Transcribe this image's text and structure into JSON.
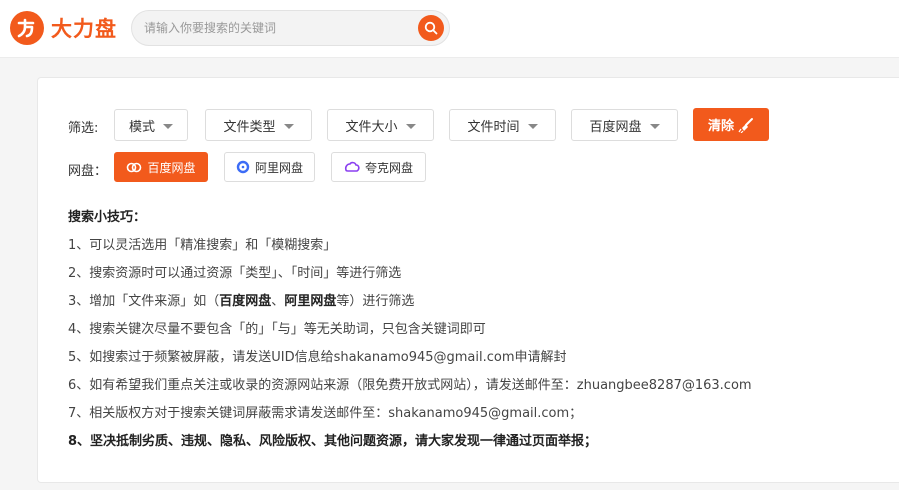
{
  "brand": {
    "name": "大力盘",
    "color": "#f25a1c"
  },
  "search": {
    "placeholder": "请输入你要搜索的关键词",
    "value": "",
    "icon": "search-icon"
  },
  "filters": {
    "label": "筛选:",
    "items": [
      {
        "label": "模式"
      },
      {
        "label": "文件类型"
      },
      {
        "label": "文件大小"
      },
      {
        "label": "文件时间"
      },
      {
        "label": "百度网盘"
      }
    ],
    "clear_label": "清除",
    "clear_icon": "broom-icon"
  },
  "disks": {
    "label": "网盘：",
    "items": [
      {
        "label": "百度网盘",
        "icon": "baidu-cloud-icon",
        "active": true
      },
      {
        "label": "阿里网盘",
        "icon": "aliyun-drive-icon",
        "active": false
      },
      {
        "label": "夸克网盘",
        "icon": "quark-drive-icon",
        "active": false
      }
    ]
  },
  "tips": {
    "title": "搜索小技巧：",
    "line1": "1、可以灵活选用「精准搜索」和「模糊搜索」",
    "line2": "2、搜索资源时可以通过资源「类型」、「时间」等进行筛选",
    "line3": {
      "prefix": "3、增加「文件来源」如（",
      "bold1": "百度网盘",
      "sep": "、",
      "bold2": "阿里网盘",
      "suffix": "等）进行筛选"
    },
    "line4": "4、搜索关键次尽量不要包含「的」「与」等无关助词，只包含关键词即可",
    "line5": "5、如搜索过于频繁被屏蔽，请发送UID信息给shakanamo945@gmail.com申请解封",
    "line6": "6、如有希望我们重点关注或收录的资源网站来源（限免费开放式网站），请发送邮件至：zhuangbee8287@163.com",
    "line7": "7、相关版权方对于搜索关键词屏蔽需求请发送邮件至：shakanamo945@gmail.com；",
    "line8": "8、坚决抵制劣质、违规、隐私、风险版权、其他问题资源，请大家发现一律通过页面举报；"
  }
}
